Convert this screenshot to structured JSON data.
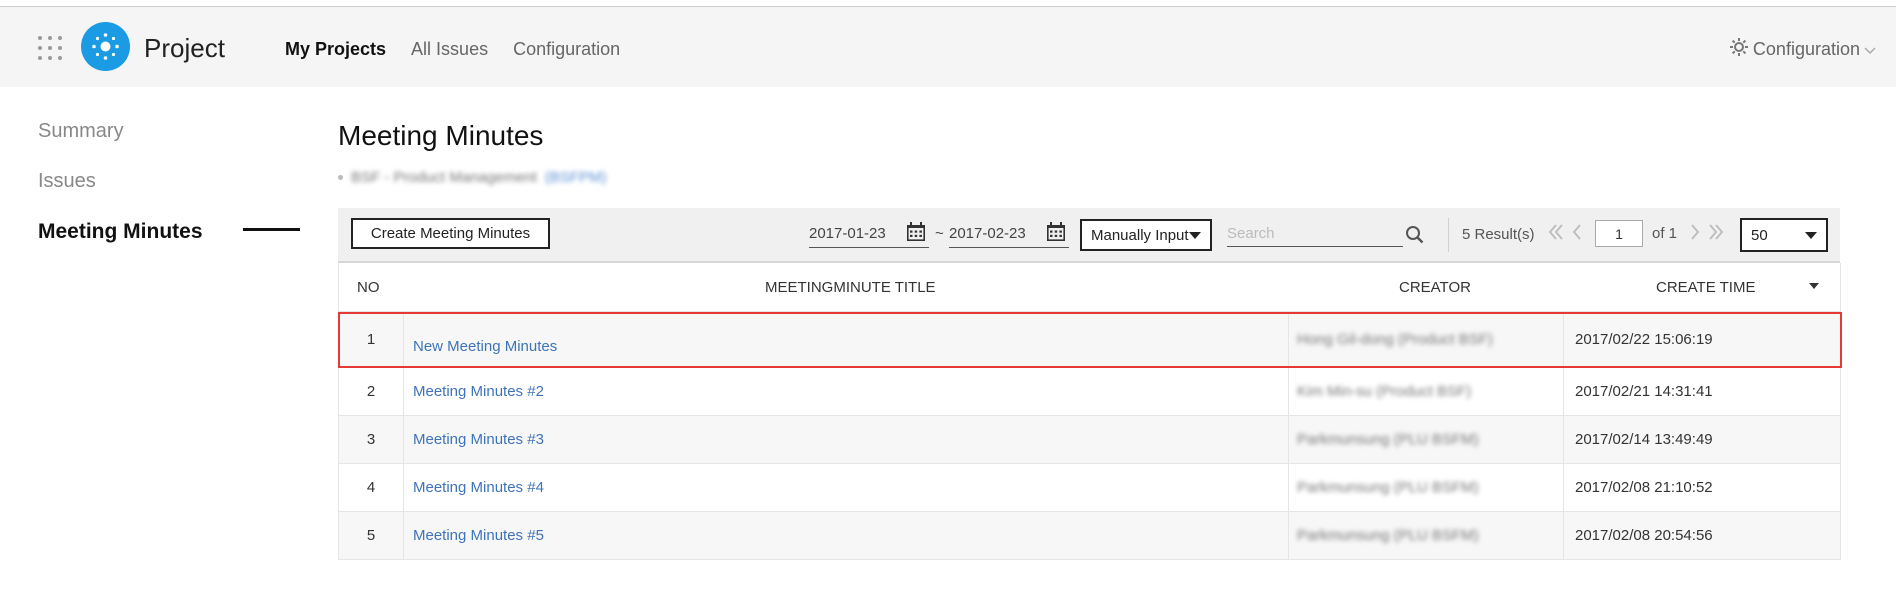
{
  "header": {
    "app_title": "Project",
    "nav": [
      "My Projects",
      "All Issues",
      "Configuration"
    ],
    "config_right": "Configuration"
  },
  "sidebar": {
    "items": [
      {
        "label": "Summary"
      },
      {
        "label": "Issues"
      },
      {
        "label": "Meeting Minutes"
      }
    ]
  },
  "main": {
    "title": "Meeting Minutes",
    "breadcrumb": {
      "project": "BSF - Product Management",
      "code": "(BSFPM)"
    }
  },
  "toolbar": {
    "create_label": "Create Meeting Minutes",
    "date_from": "2017-01-23",
    "date_to": "2017-02-23",
    "tilde": "~",
    "mode": "Manually Input",
    "search_placeholder": "Search",
    "results": "5 Result(s)",
    "page": "1",
    "of": "of 1",
    "page_size": "50"
  },
  "table": {
    "headers": {
      "no": "NO",
      "title": "MEETINGMINUTE TITLE",
      "creator": "CREATOR",
      "time": "CREATE TIME"
    },
    "rows": [
      {
        "no": "1",
        "title": "New Meeting Minutes",
        "creator": "Hong Gil-dong (Product BSF)",
        "time": "2017/02/22 15:06:19"
      },
      {
        "no": "2",
        "title": "Meeting Minutes #2",
        "creator": "Kim Min-su (Product BSF)",
        "time": "2017/02/21 14:31:41"
      },
      {
        "no": "3",
        "title": "Meeting Minutes #3",
        "creator": "Parkmunsung (PLU BSFM)",
        "time": "2017/02/14 13:49:49"
      },
      {
        "no": "4",
        "title": "Meeting Minutes #4",
        "creator": "Parkmunsung (PLU BSFM)",
        "time": "2017/02/08 21:10:52"
      },
      {
        "no": "5",
        "title": "Meeting Minutes #5",
        "creator": "Parkmunsung (PLU BSFM)",
        "time": "2017/02/08 20:54:56"
      }
    ]
  },
  "colors": {
    "accent": "#1a9be3",
    "link": "#3e73b8",
    "highlight": "#e53935"
  },
  "icons": [
    "app-grid-icon",
    "logo-icon",
    "gear-icon",
    "calendar-icon",
    "search-icon",
    "first-page-icon",
    "prev-page-icon",
    "next-page-icon",
    "last-page-icon"
  ]
}
